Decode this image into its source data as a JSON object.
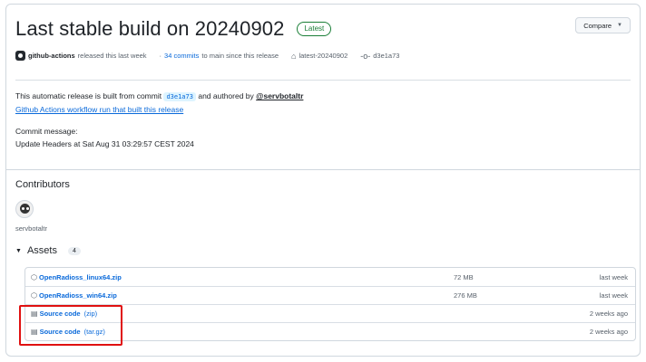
{
  "release": {
    "title": "Last stable build on 20240902",
    "latest_badge": "Latest",
    "compare_button": "Compare",
    "author": "github-actions",
    "released_text": "released this last week",
    "commits_link": "34 commits",
    "commits_suffix": "to main since this release",
    "tag": "latest-20240902",
    "commit": "d3e1a73"
  },
  "description": {
    "line1_prefix": "This automatic release is built from commit",
    "commit_chip": "d3e1a73",
    "line1_middle": "and authored by",
    "author_mention": "@servbotaltr",
    "workflow_link": "Github Actions workflow run that built this release",
    "commit_message_label": "Commit message:",
    "commit_message": "Update Headers at Sat Aug 31 03:29:57 CEST 2024"
  },
  "contributors": {
    "title": "Contributors",
    "name": "servbotaltr"
  },
  "assets": {
    "title": "Assets",
    "count": "4",
    "items": [
      {
        "name": "OpenRadioss_linux64.zip",
        "sub": "",
        "size": "72 MB",
        "date": "last week"
      },
      {
        "name": "OpenRadioss_win64.zip",
        "sub": "",
        "size": "276 MB",
        "date": "last week"
      },
      {
        "name": "Source code",
        "sub": "(zip)",
        "size": "",
        "date": "2 weeks ago"
      },
      {
        "name": "Source code",
        "sub": "(tar.gz)",
        "size": "",
        "date": "2 weeks ago"
      }
    ]
  },
  "colors": {
    "accent": "#0969da",
    "latest_green": "#1a7f37",
    "highlight_red": "#e01010"
  }
}
